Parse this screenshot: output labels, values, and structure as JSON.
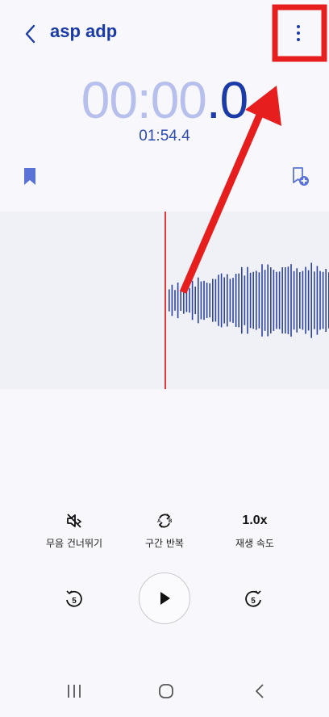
{
  "header": {
    "title": "asp adp",
    "back_icon": "chevron-left-icon",
    "more_icon": "more-vertical-icon"
  },
  "timer": {
    "elapsed_main": "00:00",
    "elapsed_tenth": ".0",
    "total": "01:54.4"
  },
  "icons": {
    "bookmark": "bookmark-icon",
    "add_bookmark": "add-bookmark-icon"
  },
  "controls": {
    "skip_silence_label": "무음 건너뛰기",
    "repeat_label": "구간 반복",
    "speed_value": "1.0x",
    "speed_label": "재생 속도",
    "skip_back_seconds": "5",
    "skip_forward_seconds": "5"
  },
  "colors": {
    "accent": "#1b3ba8",
    "accent_light": "#b7c0ec",
    "playhead": "#e53935",
    "annotation": "#e61e1e"
  }
}
